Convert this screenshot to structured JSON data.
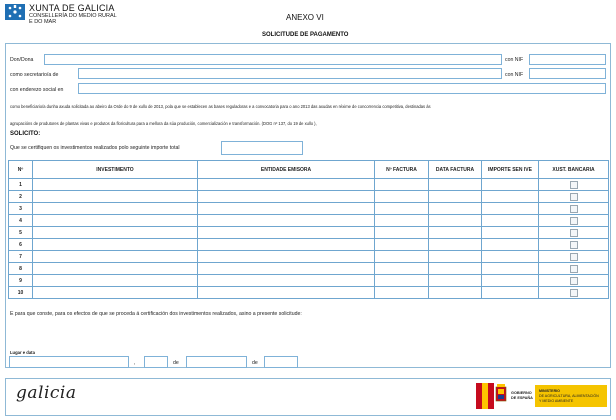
{
  "header": {
    "org_name": "XUNTA DE GALICIA",
    "dept_line1": "CONSELLERÍA DO MEDIO RURAL",
    "dept_line2": "E DO MAR",
    "annex": "ANEXO VI",
    "title": "SOLICITUDE DE PAGAMENTO"
  },
  "applicant": {
    "don_label": "Don/Dona",
    "nif_label": "con NIF",
    "secretary_label": "como secretario/a de",
    "address_label": "con enderezo social en"
  },
  "paragraph": {
    "line1": "como beneficiario/a dunha axuda solicitada ao abeiro da Orde do 9 de xullo de 2013, pola que se establecen as bases reguladoras e a convocatoria para o ano 2013 das axudas en réxime de concorrencia competitiva, destinadas ás",
    "line2": "agrupacións de produtores de plantas vivas e produtos da floricultura para a mellora da súa produción, comercialización e transformación. (DOG nº 137, do 19 de xullo ),"
  },
  "request": {
    "heading": "SOLICITO:",
    "total_label": "Que se certifiquen os investimentos realizados polo seguinte importe total"
  },
  "table": {
    "headers": [
      "Nº",
      "INVESTIMENTO",
      "ENTIDADE EMISORA",
      "Nº FACTURA",
      "DATA FACTURA",
      "IMPORTE SEN IVE",
      "XUST. BANCARIA"
    ],
    "rows": [
      "1",
      "2",
      "3",
      "4",
      "5",
      "6",
      "7",
      "8",
      "9",
      "10"
    ]
  },
  "footer": {
    "statement": "E para que conste, para os efectos de que se proceda á certificación dos investimentos realizados, asino a presente  solicitude:",
    "place_label": "Lugar e data",
    "comma": ",",
    "de1": "de",
    "de2": "de",
    "galicia_logo": "galicia",
    "ministry_line1": "MINISTERIO",
    "ministry_line2": "DE AGRICULTURA, ALIMENTACIÓN",
    "ministry_line3": "Y MEDIO AMBIENTE",
    "gov_line1": "GOBIERNO",
    "gov_line2": "DE ESPAÑA"
  }
}
